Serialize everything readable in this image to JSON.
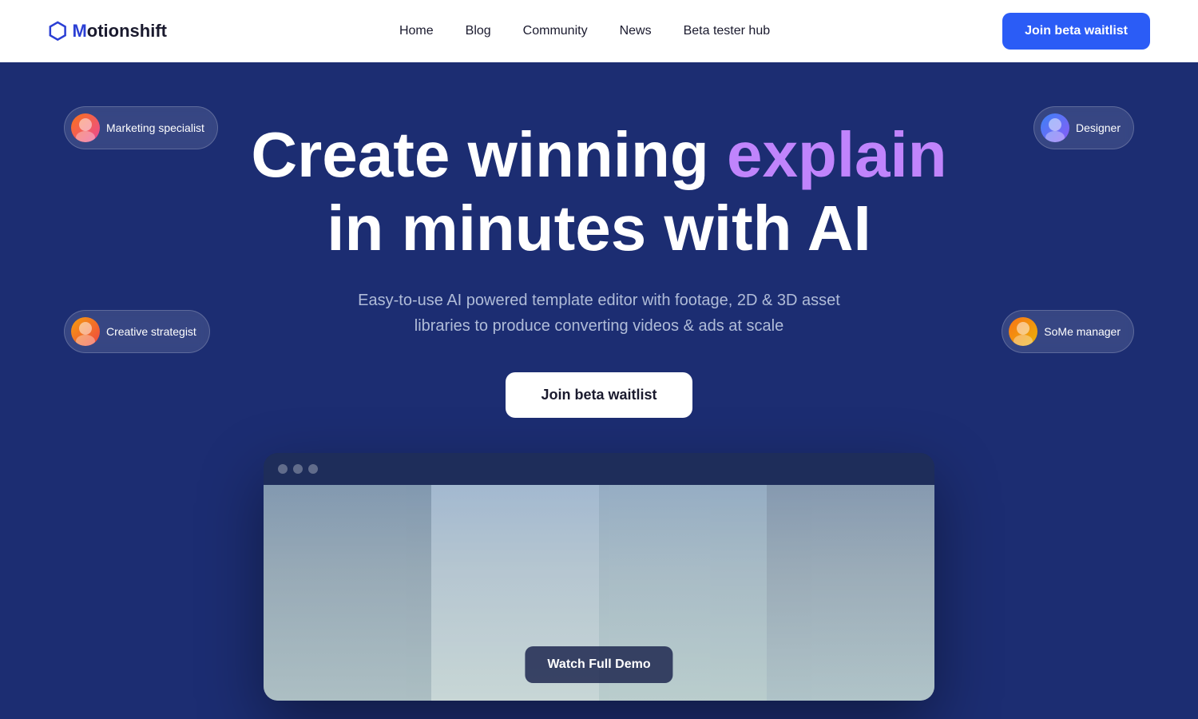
{
  "brand": {
    "logo_letter": "M",
    "logo_name": "otionshift"
  },
  "nav": {
    "links": [
      {
        "id": "home",
        "label": "Home"
      },
      {
        "id": "blog",
        "label": "Blog"
      },
      {
        "id": "community",
        "label": "Community"
      },
      {
        "id": "news",
        "label": "News"
      },
      {
        "id": "beta",
        "label": "Beta tester hub"
      }
    ],
    "cta": "Join beta waitlist"
  },
  "hero": {
    "title_part1": "Create winning ",
    "title_accent": "explain",
    "title_part2": "in minutes with AI",
    "subtitle_line1": "Easy-to-use AI powered template editor with footage, 2D & 3D asset",
    "subtitle_line2": "libraries to produce converting videos & ads at scale",
    "cta": "Join beta waitlist"
  },
  "badges": {
    "marketing": "Marketing specialist",
    "designer": "Designer",
    "creative": "Creative strategist",
    "some": "SoMe manager"
  },
  "demo": {
    "dots": [
      "●",
      "●",
      "●"
    ],
    "watch_label": "Watch Full Demo"
  },
  "colors": {
    "accent_purple": "#c084fc",
    "nav_cta_bg": "#2b5cf6",
    "hero_bg": "#1c2d72"
  }
}
